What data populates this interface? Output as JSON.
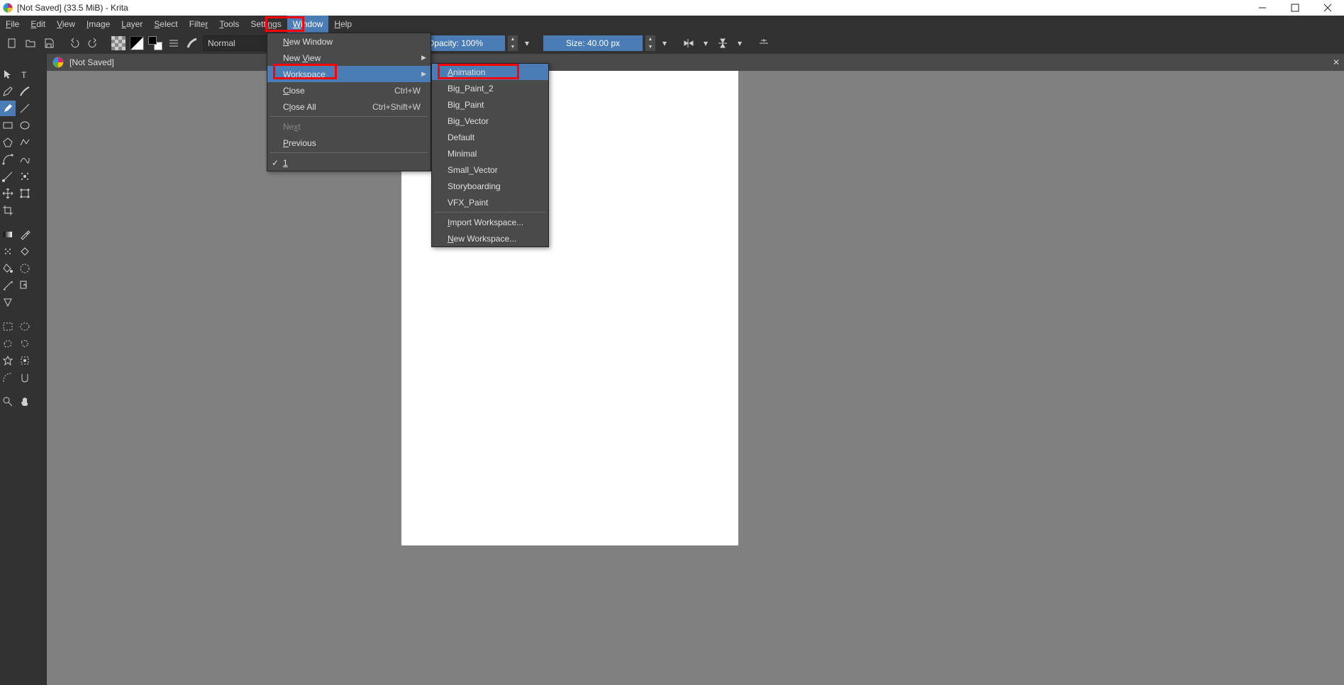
{
  "title": "[Not Saved]  (33.5 MiB)  - Krita",
  "menubar": [
    "File",
    "Edit",
    "View",
    "Image",
    "Layer",
    "Select",
    "Filter",
    "Tools",
    "Settings",
    "Window",
    "Help"
  ],
  "toolbar": {
    "blend_mode": "Normal",
    "opacity_label": "Opacity: 100%",
    "size_label": "Size: 40.00 px"
  },
  "document_tab": "[Not Saved]",
  "window_menu": {
    "items": [
      {
        "label": "New Window",
        "ul": "N"
      },
      {
        "label": "New View",
        "ul": "V",
        "submenu": true
      },
      {
        "label": "Workspace",
        "ul": "k",
        "submenu": true,
        "highlight": true
      },
      {
        "label": "Close",
        "ul": "C",
        "shortcut": "Ctrl+W"
      },
      {
        "label": "Close All",
        "ul": "l",
        "shortcut": "Ctrl+Shift+W"
      },
      {
        "label": "Next",
        "ul": "x",
        "disabled": true
      },
      {
        "label": "Previous",
        "ul": "P"
      },
      {
        "label": "1",
        "ul": "1",
        "checked": true
      }
    ]
  },
  "workspace_menu": {
    "items": [
      {
        "label": "Animation",
        "ul": "A",
        "highlight": true
      },
      {
        "label": "Big_Paint_2"
      },
      {
        "label": "Big_Paint"
      },
      {
        "label": "Big_Vector"
      },
      {
        "label": "Default"
      },
      {
        "label": "Minimal"
      },
      {
        "label": "Small_Vector"
      },
      {
        "label": "Storyboarding"
      },
      {
        "label": "VFX_Paint"
      },
      {
        "label": "Import Workspace...",
        "ul": "I"
      },
      {
        "label": "New Workspace...",
        "ul": "N"
      }
    ]
  }
}
